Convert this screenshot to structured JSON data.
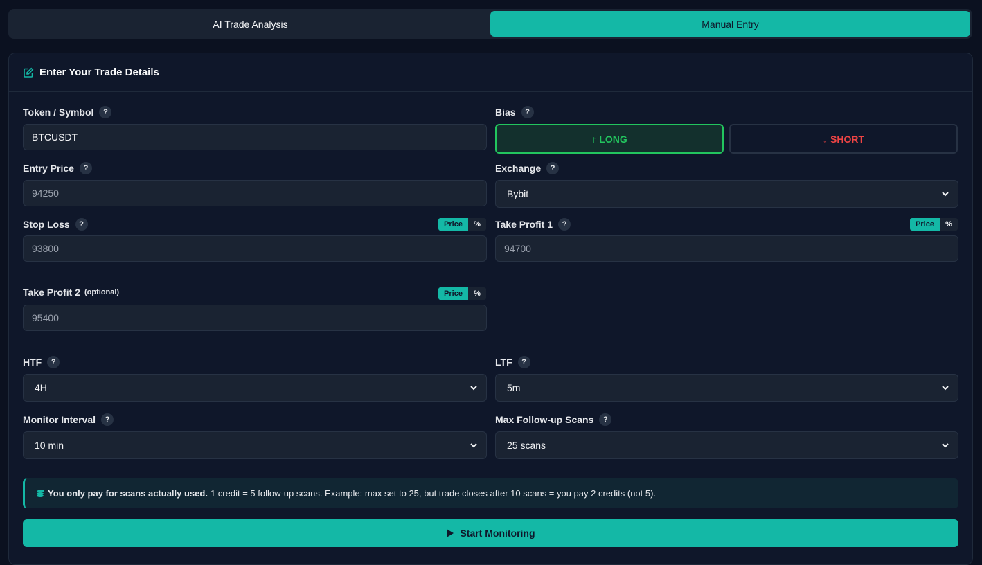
{
  "tabs": [
    {
      "label": "AI Trade Analysis",
      "active": false
    },
    {
      "label": "Manual Entry",
      "active": true
    }
  ],
  "card": {
    "title": "Enter Your Trade Details"
  },
  "fields": {
    "token": {
      "label": "Token / Symbol",
      "value": "BTCUSDT"
    },
    "bias": {
      "label": "Bias",
      "long": "LONG",
      "short": "SHORT",
      "selected": "LONG"
    },
    "entry": {
      "label": "Entry Price",
      "placeholder": "94250"
    },
    "exchange": {
      "label": "Exchange",
      "value": "Bybit"
    },
    "stop_loss": {
      "label": "Stop Loss",
      "placeholder": "93800"
    },
    "take_profit_1": {
      "label": "Take Profit 1",
      "placeholder": "94700"
    },
    "take_profit_2": {
      "label": "Take Profit 2",
      "optional": "(optional)",
      "placeholder": "95400"
    },
    "htf": {
      "label": "HTF",
      "value": "4H"
    },
    "ltf": {
      "label": "LTF",
      "value": "5m"
    },
    "monitor_interval": {
      "label": "Monitor Interval",
      "value": "10 min"
    },
    "max_scans": {
      "label": "Max Follow-up Scans",
      "value": "25 scans"
    }
  },
  "toggle": {
    "price": "Price",
    "percent": "%"
  },
  "help_glyph": "?",
  "info": {
    "bold": "You only pay for scans actually used.",
    "text": "1 credit = 5 follow-up scans. Example: max set to 25, but trade closes after 10 scans = you pay 2 credits (not 5)."
  },
  "start_button": "Start Monitoring",
  "colors": {
    "accent": "#14b8a6",
    "long": "#22c55e",
    "short": "#ef4444",
    "background": "#0b1120"
  }
}
